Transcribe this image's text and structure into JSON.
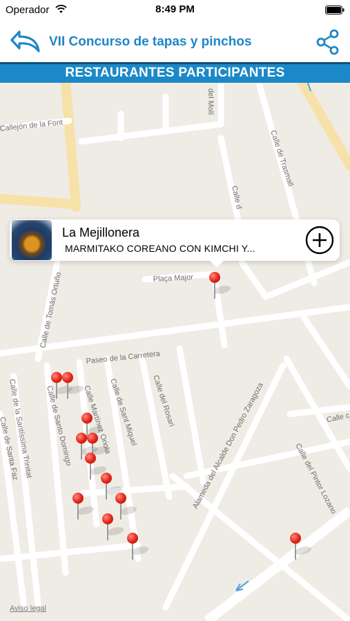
{
  "status_bar": {
    "carrier": "Operador",
    "time": "8:49 PM"
  },
  "nav": {
    "title": "VII Concurso de tapas y pinchos",
    "back_icon": "back-arrow-icon",
    "share_icon": "share-icon"
  },
  "section": {
    "title": "RESTAURANTES PARTICIPANTES"
  },
  "map": {
    "streets": [
      "del Molí",
      "Callejón de la Font",
      "Calle de Trasmall",
      "Calle d",
      "Calle de Tomás Ortuño",
      "Plaça Major",
      "Paseo de la Carretera",
      "Calle de Santo Domingo",
      "Calle Martínez Oriola",
      "Calle de Sant Miquel",
      "Calle del Rosari",
      "Calle de la Santíssima Trinitat",
      "Calle de Santa Faz",
      "Alameda del Alcalde Don Pedro Zaragoza",
      "Calle del Pintor Lozano",
      "Calle c"
    ],
    "legal": "Aviso legal",
    "pin_count": 15
  },
  "callout": {
    "title": "La Mejillonera",
    "subtitle": "MARMITAKO COREANO CON KIMCHI Y...",
    "action_icon": "plus-circle-icon"
  },
  "colors": {
    "accent": "#1f86c6",
    "banner": "#1b89c8",
    "pin": "#e32116",
    "map_bg": "#efece5"
  }
}
